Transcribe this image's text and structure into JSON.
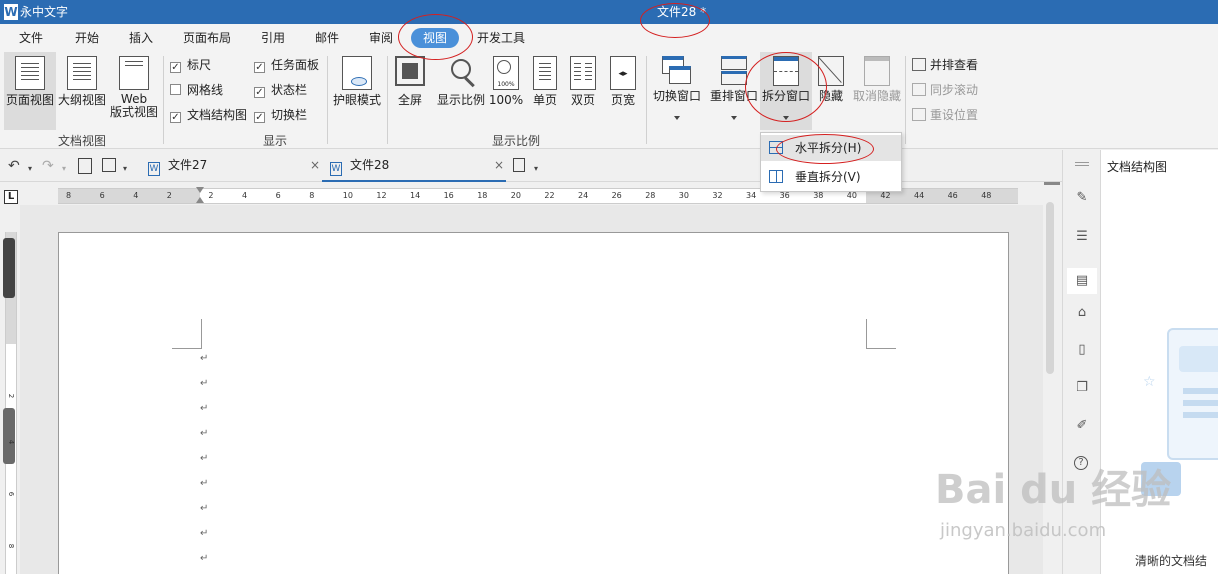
{
  "window": {
    "app_name": "永中文字",
    "doc_title": "文件28 *",
    "logo_letter": "W"
  },
  "menu": {
    "tabs": [
      "文件",
      "开始",
      "插入",
      "页面布局",
      "引用",
      "邮件",
      "审阅",
      "视图",
      "开发工具"
    ],
    "active": "视图"
  },
  "ribbon": {
    "doc_view": {
      "label": "文档视图",
      "page_view": "页面视图",
      "outline_view": "大纲视图",
      "web_view_1": "Web",
      "web_view_2": "版式视图"
    },
    "show": {
      "label": "显示",
      "ruler": "标尺",
      "gridlines": "网格线",
      "doc_map": "文档结构图",
      "task_pane": "任务面板",
      "status_bar": "状态栏",
      "switch_bar": "切换栏",
      "ruler_checked": true,
      "gridlines_checked": false,
      "doc_map_checked": true,
      "task_pane_checked": true,
      "status_bar_checked": true,
      "switch_bar_checked": true
    },
    "eye_mode": "护眼模式",
    "zoom": {
      "label": "显示比例",
      "fullscreen": "全屏",
      "zoom_ratio": "显示比例",
      "hundred": "100%",
      "one_page": "单页",
      "two_page": "双页",
      "page_width": "页宽",
      "hundred_badge": "100%"
    },
    "window": {
      "switch_window": "切换窗口",
      "arrange_window": "重排窗口",
      "split_window": "拆分窗口",
      "hide": "隐藏",
      "unhide": "取消隐藏",
      "side_by_side": "并排查看",
      "sync_scroll": "同步滚动",
      "reset_position": "重设位置"
    }
  },
  "split_menu": {
    "horizontal": "水平拆分(H)",
    "vertical": "垂直拆分(V)"
  },
  "tabs": [
    {
      "name": "文件27"
    },
    {
      "name": "文件28"
    }
  ],
  "ruler": {
    "corner": "L",
    "h_ticks": [
      "8",
      "6",
      "4",
      "2",
      "2",
      "4",
      "6",
      "8",
      "10",
      "12",
      "14",
      "16",
      "18",
      "20",
      "22",
      "24",
      "26",
      "28",
      "30",
      "32",
      "34",
      "36",
      "38",
      "40",
      "42",
      "44",
      "46",
      "48"
    ],
    "v_ticks": [
      "2",
      "4",
      "6",
      "8"
    ]
  },
  "document": {
    "para_mark": "↵",
    "paragraph_count": 9
  },
  "side_panel": {
    "title": "文档结构图",
    "hint": "清晰的文档结"
  },
  "watermark": {
    "main": "Bai du 经验",
    "sub": "jingyan.baidu.com"
  }
}
